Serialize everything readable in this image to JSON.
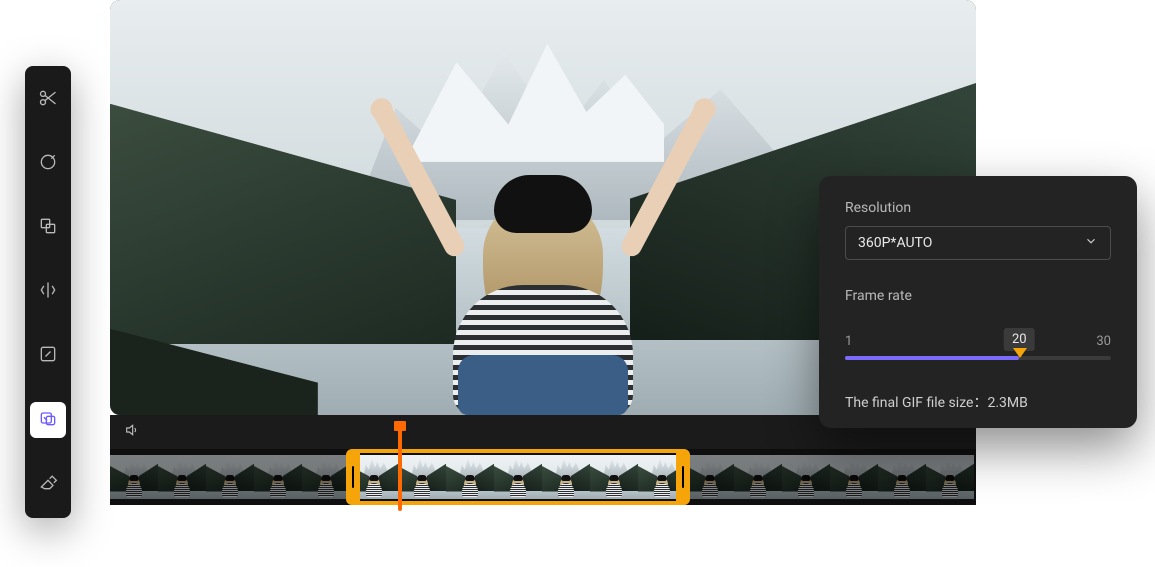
{
  "toolbar": {
    "items": [
      {
        "name": "cut-tool",
        "icon": "scissors"
      },
      {
        "name": "draw-tool",
        "icon": "target"
      },
      {
        "name": "crop-tool",
        "icon": "copy"
      },
      {
        "name": "mirror-tool",
        "icon": "mirror"
      },
      {
        "name": "resize-tool",
        "icon": "resize"
      },
      {
        "name": "export-gif-tool",
        "icon": "export",
        "active": true
      },
      {
        "name": "erase-tool",
        "icon": "eraser"
      }
    ]
  },
  "controls": {
    "volume_icon": "speaker"
  },
  "timeline": {
    "total_thumbs": 18,
    "selection_start_thumb": 5,
    "selection_end_thumb": 12,
    "playhead_thumb": 6
  },
  "panel": {
    "resolution_label": "Resolution",
    "resolution_value": "360P*AUTO",
    "frame_rate_label": "Frame rate",
    "frame_rate_value": 20,
    "frame_rate_min": 1,
    "frame_rate_max": 30,
    "final_size_label": "The final GIF file size：2.3MB"
  },
  "colors": {
    "accent": "#7b6bff",
    "selection": "#f5a50a",
    "playhead": "#ff6a00"
  }
}
